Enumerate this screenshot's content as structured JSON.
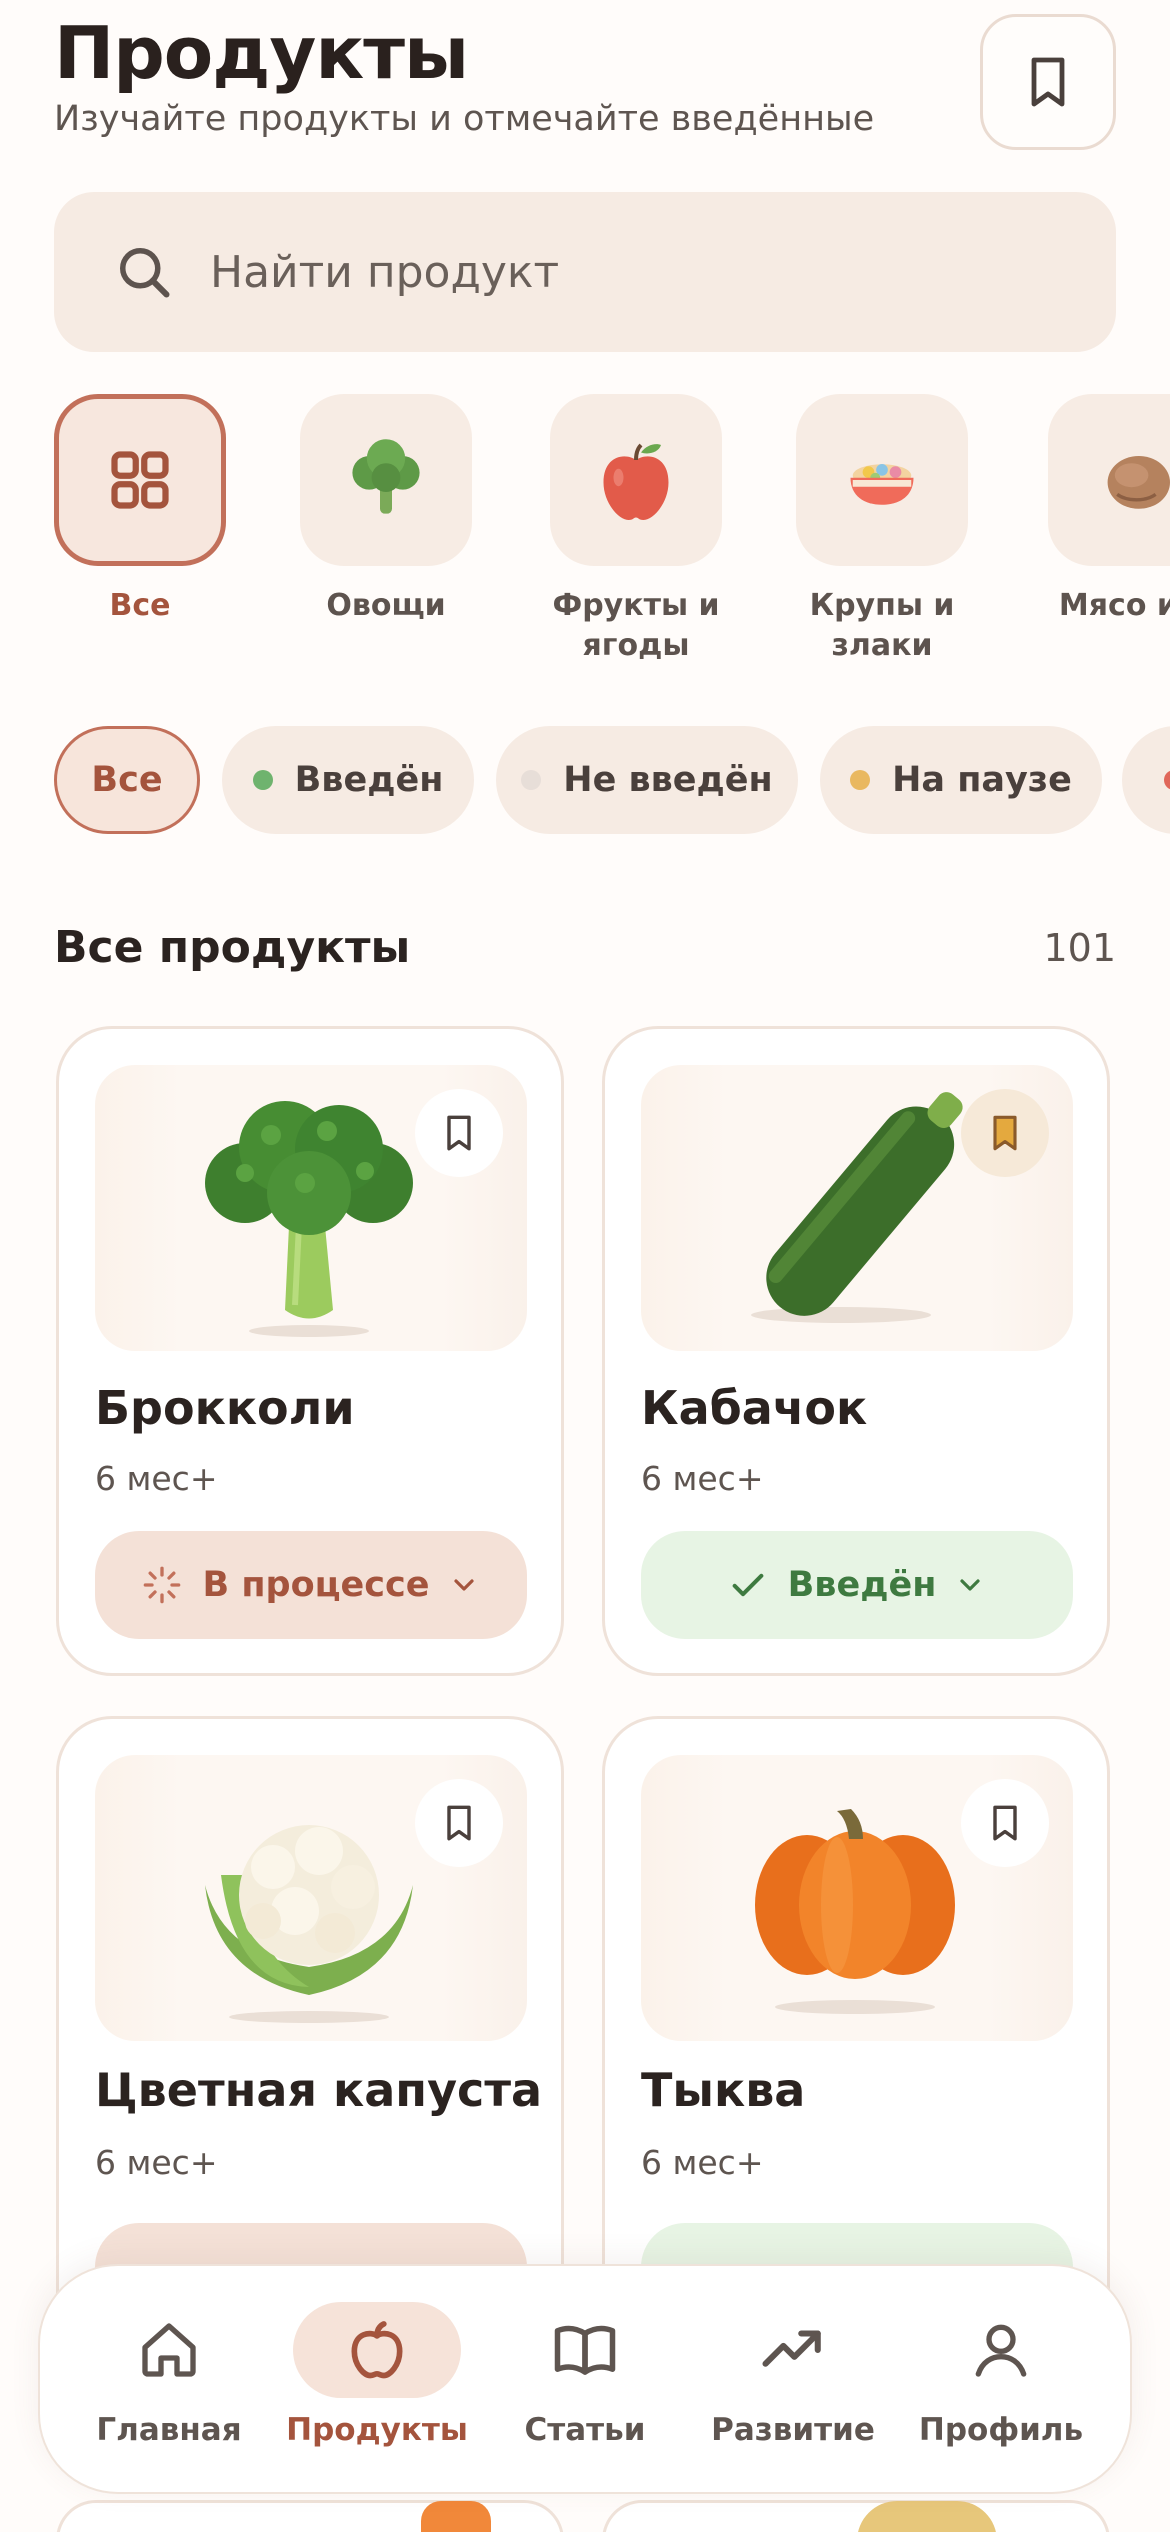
{
  "header": {
    "title": "Продукты",
    "subtitle": "Изучайте продукты и отмечайте введённые",
    "bookmark_icon": "bookmark-icon"
  },
  "search": {
    "placeholder": "Найти продукт",
    "icon": "search-icon"
  },
  "categories": [
    {
      "label": "Все",
      "icon": "grid-icon",
      "active": true
    },
    {
      "label": "Овощи",
      "icon": "broccoli-icon",
      "active": false
    },
    {
      "label": "Фрукты и ягоды",
      "icon": "apple-icon",
      "active": false
    },
    {
      "label": "Крупы и злаки",
      "icon": "grain-bowl-icon",
      "active": false
    },
    {
      "label": "Мясо и п",
      "icon": "meat-icon",
      "active": false
    }
  ],
  "filters": [
    {
      "label": "Все",
      "active": true
    },
    {
      "label": "Введён",
      "dot_color": "#6FB36E"
    },
    {
      "label": "Не введён",
      "dot_color": "#E7DED8"
    },
    {
      "label": "На паузе",
      "dot_color": "#E9B860"
    }
  ],
  "section": {
    "title": "Все продукты",
    "count": "101"
  },
  "products": [
    {
      "name": "Брокколи",
      "age": "6 мес+",
      "status": "В процессе",
      "status_type": "in-progress",
      "saved": false
    },
    {
      "name": "Кабачок",
      "age": "6 мес+",
      "status": "Введён",
      "status_type": "done",
      "saved": true
    },
    {
      "name": "Цветная капуста",
      "age": "6 мес+",
      "saved": false
    },
    {
      "name": "Тыква",
      "age": "6 мес+",
      "saved": false
    }
  ],
  "tabbar": [
    {
      "label": "Главная",
      "icon": "home-icon",
      "active": false
    },
    {
      "label": "Продукты",
      "icon": "apple-icon",
      "active": true
    },
    {
      "label": "Статьи",
      "icon": "book-icon",
      "active": false
    },
    {
      "label": "Развитие",
      "icon": "trending-up-icon",
      "active": false
    },
    {
      "label": "Профиль",
      "icon": "user-icon",
      "active": false
    }
  ],
  "colors": {
    "accent": "#A4543D",
    "accent_border": "#C2705A",
    "success": "#3E7A40",
    "success_bg": "#E7F4E4",
    "chip_bg": "#F6EBE3"
  }
}
